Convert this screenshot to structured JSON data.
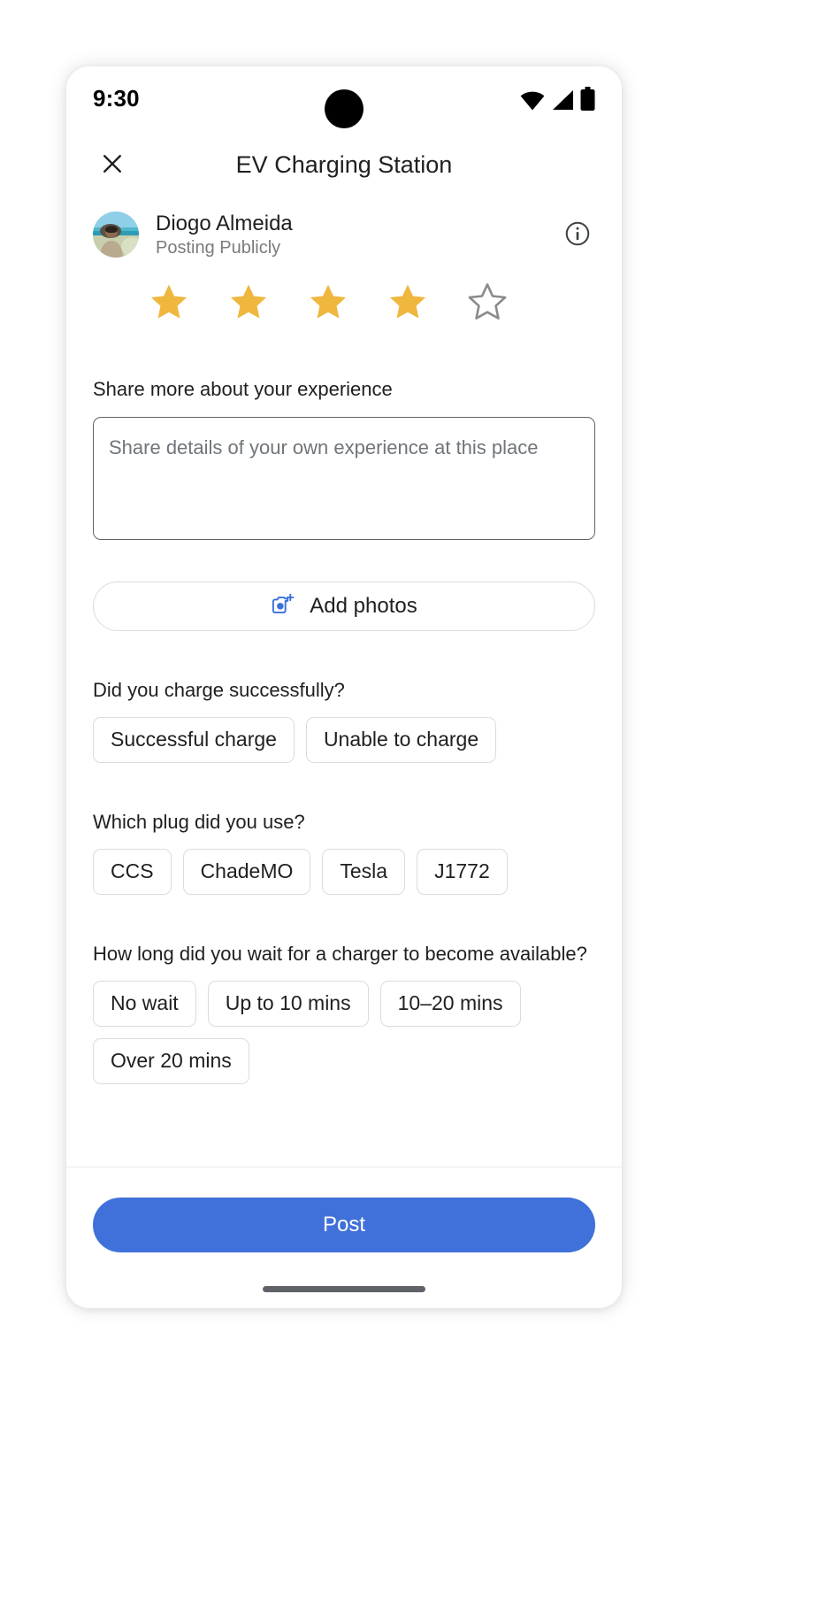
{
  "status_bar": {
    "time": "9:30",
    "icons": [
      "wifi-icon",
      "cell-signal-icon",
      "battery-icon"
    ]
  },
  "header": {
    "close_icon": "close-icon",
    "title": "EV Charging Station"
  },
  "profile": {
    "name": "Diogo Almeida",
    "visibility": "Posting Publicly",
    "info_icon": "info-icon",
    "avatar": "user-avatar"
  },
  "rating": {
    "value": 4,
    "max": 5,
    "filled_color": "#EFB73E",
    "empty_color": "#8a8a8a"
  },
  "experience": {
    "label": "Share more about your experience",
    "placeholder": "Share details of your own experience at this place",
    "value": ""
  },
  "add_photos": {
    "label": "Add photos",
    "icon": "add-photo-camera-icon",
    "icon_color": "#3b72d9"
  },
  "questions": [
    {
      "id": "charge-success",
      "label": "Did you charge successfully?",
      "options": [
        "Successful charge",
        "Unable to charge"
      ]
    },
    {
      "id": "plug-type",
      "label": "Which plug did you use?",
      "options": [
        "CCS",
        "ChadeMO",
        "Tesla",
        "J1772"
      ]
    },
    {
      "id": "wait-time",
      "label": "How long did you wait for a charger to become available?",
      "options": [
        "No wait",
        "Up to 10 mins",
        "10–20 mins",
        "Over 20 mins"
      ]
    }
  ],
  "footer": {
    "post_label": "Post",
    "post_color": "#4070da"
  }
}
